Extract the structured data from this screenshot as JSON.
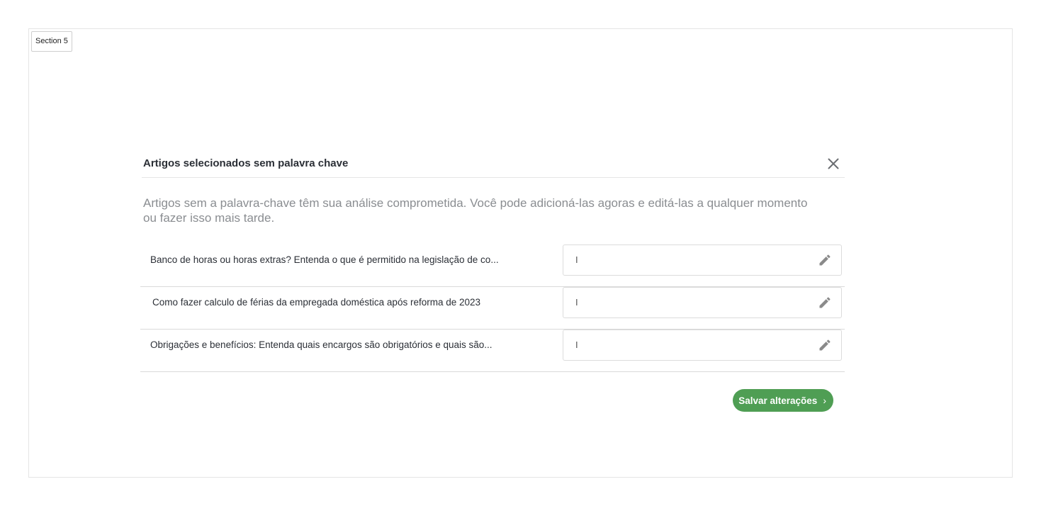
{
  "section": {
    "label": "Section 5"
  },
  "modal": {
    "title": "Artigos selecionados sem palavra chave",
    "description": "Artigos sem a palavra-chave têm sua análise comprometida. Você pode adicioná-las agoras e editá-las a qualquer momento ou fazer isso mais tarde.",
    "rows": [
      {
        "title": "Banco de horas ou horas extras? Entenda o que é permitido na legislação de co...",
        "keyword": "I"
      },
      {
        "title": "Como fazer calculo de férias da empregada doméstica após reforma de 2023",
        "keyword": "I"
      },
      {
        "title": "Obrigações e benefícios: Entenda quais encargos são obrigatórios e quais são...",
        "keyword": "I"
      }
    ],
    "save_label": "Salvar alterações",
    "save_icon": "chevron-right-icon",
    "close_icon": "close-icon",
    "edit_icon": "pencil-icon"
  },
  "colors": {
    "primary_button": "#4f9e54",
    "title_text": "#2b2f36",
    "description_text": "#8a8d91"
  }
}
